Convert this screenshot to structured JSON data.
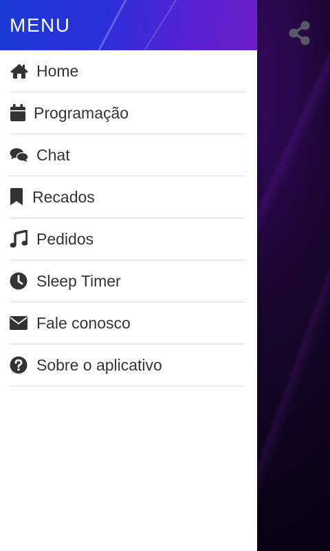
{
  "drawer": {
    "title": "MENU",
    "items": [
      {
        "label": "Home",
        "icon": "home-icon"
      },
      {
        "label": "Programação",
        "icon": "calendar-icon"
      },
      {
        "label": "Chat",
        "icon": "chat-icon"
      },
      {
        "label": "Recados",
        "icon": "bookmark-icon"
      },
      {
        "label": "Pedidos",
        "icon": "music-icon"
      },
      {
        "label": "Sleep Timer",
        "icon": "clock-icon"
      },
      {
        "label": "Fale conosco",
        "icon": "envelope-icon"
      },
      {
        "label": "Sobre o aplicativo",
        "icon": "question-circle-icon"
      }
    ]
  },
  "topbar": {
    "share_icon": "share-icon"
  },
  "colors": {
    "header_start": "#1b3bd6",
    "header_end": "#6b1ec8",
    "icon": "#333333",
    "background": "#0d0418"
  }
}
